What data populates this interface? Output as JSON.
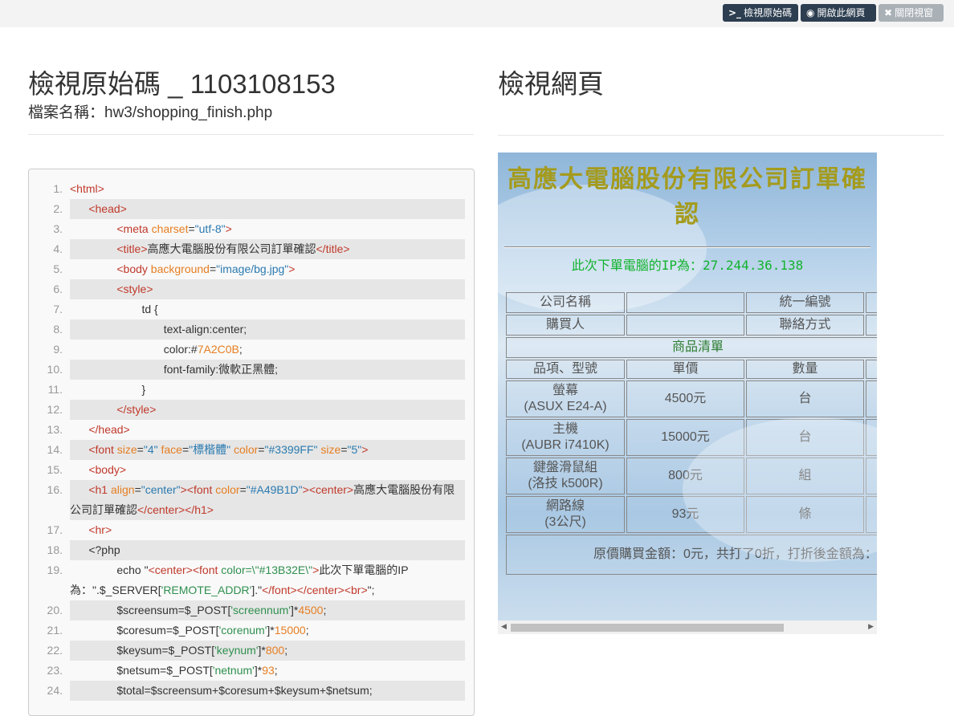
{
  "toolbar": {
    "view_source": "檢視原始碼",
    "open_page": "開啟此網頁",
    "close_window": "關閉視窗",
    "view_source_icon": "terminal-icon",
    "open_page_icon": "globe-icon",
    "close_icon": "close-icon"
  },
  "left": {
    "title": "檢視原始碼 _ 1103108153",
    "file_label": "檔案名稱：hw3/shopping_finish.php"
  },
  "right": {
    "title": "檢視網頁"
  },
  "preview": {
    "heading": "高應大電腦股份有限公司訂單確認",
    "ip_line": "此次下單電腦的IP為：27.244.36.138",
    "table": {
      "company_label": "公司名稱",
      "tax_label": "統一編號",
      "buyer_label": "購買人",
      "contact_label": "聯絡方式",
      "list_title": "商品清單",
      "col_item": "品項、型號",
      "col_price": "單價",
      "col_qty": "數量",
      "items": [
        {
          "name": "螢幕",
          "model": "(ASUX E24-A)",
          "price": "4500元",
          "unit": "台"
        },
        {
          "name": "主機",
          "model": "(AUBR i7410K)",
          "price": "15000元",
          "unit": "台"
        },
        {
          "name": "鍵盤滑鼠組",
          "model": "(洛技 k500R)",
          "price": "800元",
          "unit": "組"
        },
        {
          "name": "網路線",
          "model": "(3公尺)",
          "price": "93元",
          "unit": "條"
        }
      ],
      "summary": "原價購買金額：0元，共打了0折，打折後金額為："
    }
  },
  "code": {
    "line_numbers": [
      "1.",
      "2.",
      "3.",
      "4.",
      "5.",
      "6.",
      "7.",
      "8.",
      "9.",
      "10.",
      "11.",
      "12.",
      "13.",
      "14.",
      "15.",
      "16.",
      "17.",
      "18.",
      "19.",
      "20.",
      "21.",
      "22.",
      "23.",
      "24."
    ]
  }
}
